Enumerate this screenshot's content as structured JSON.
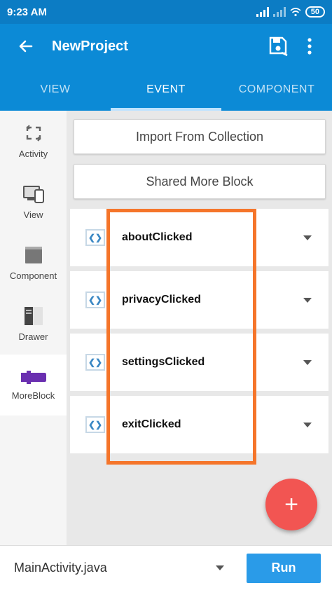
{
  "status": {
    "time": "9:23 AM",
    "battery": "50"
  },
  "appbar": {
    "title": "NewProject",
    "back_icon": "arrow-left-icon",
    "save_icon": "save-icon",
    "more_icon": "more-vert-icon"
  },
  "tabs": [
    {
      "label": "VIEW"
    },
    {
      "label": "EVENT"
    },
    {
      "label": "COMPONENT"
    }
  ],
  "active_tab": "EVENT",
  "sidebar": {
    "items": [
      {
        "label": "Activity",
        "icon": "activity-icon"
      },
      {
        "label": "View",
        "icon": "view-icon"
      },
      {
        "label": "Component",
        "icon": "component-icon"
      },
      {
        "label": "Drawer",
        "icon": "drawer-icon"
      },
      {
        "label": "MoreBlock",
        "icon": "moreblock-icon"
      }
    ],
    "active": "MoreBlock"
  },
  "actions": {
    "import_label": "Import From Collection",
    "shared_label": "Shared More Block"
  },
  "events": [
    {
      "name": "aboutClicked"
    },
    {
      "name": "privacyClicked"
    },
    {
      "name": "settingsClicked"
    },
    {
      "name": "exitClicked"
    }
  ],
  "fab": {
    "label": "+"
  },
  "bottom": {
    "file": "MainActivity.java",
    "run_label": "Run"
  },
  "colors": {
    "primary": "#0c8ad6",
    "status": "#0c7cc4",
    "fab": "#f25552",
    "run": "#2a9be8",
    "highlight": "#f5752a",
    "moreblock": "#6a2fb0"
  }
}
